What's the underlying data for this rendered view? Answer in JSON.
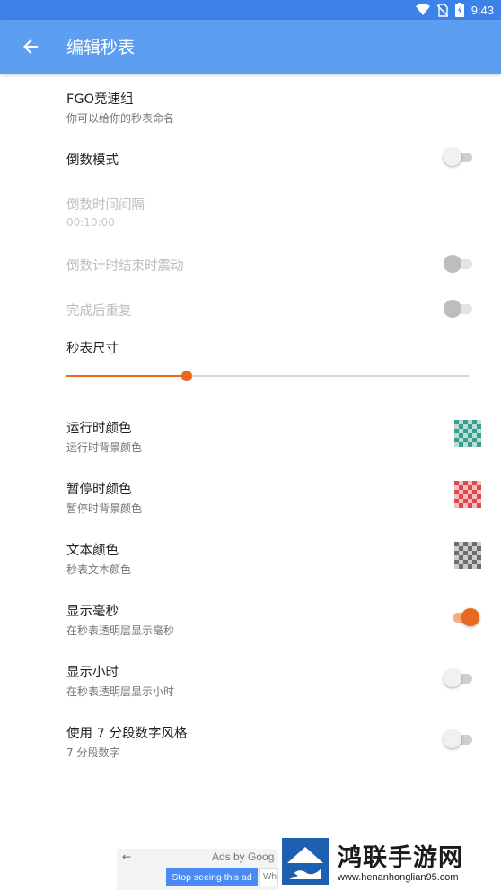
{
  "status_bar": {
    "time": "9:43",
    "icons": [
      "wifi-icon",
      "no-sim-icon",
      "battery-icon"
    ]
  },
  "app_bar": {
    "title": "编辑秒表",
    "back_icon": "arrow-back-icon"
  },
  "settings": {
    "name": {
      "title": "FGO竞速组",
      "summary": "你可以给你的秒表命名"
    },
    "countdown_mode": {
      "title": "倒数模式",
      "on": false
    },
    "countdown_interval": {
      "title": "倒数时间间隔",
      "summary": "00:10:00",
      "enabled": false
    },
    "vibrate_on_end": {
      "title": "倒数计时结束时震动",
      "on": false,
      "enabled": false
    },
    "repeat_after_done": {
      "title": "完成后重复",
      "on": false,
      "enabled": false
    },
    "stopwatch_size": {
      "title": "秒表尺寸",
      "value": 0.3
    },
    "running_color": {
      "title": "运行时颜色",
      "summary": "运行时背景颜色",
      "color": "#3a9e8c"
    },
    "paused_color": {
      "title": "暂停时颜色",
      "summary": "暂停时背景颜色",
      "color": "#e0474c"
    },
    "text_color": {
      "title": "文本颜色",
      "summary": "秒表文本颜色",
      "color": "#6e6e6e"
    },
    "show_milliseconds": {
      "title": "显示毫秒",
      "summary": "在秒表透明层显示毫秒",
      "on": true
    },
    "show_hours": {
      "title": "显示小时",
      "summary": "在秒表透明层显示小时",
      "on": false
    },
    "seven_segment": {
      "title": "使用 7 分段数字风格",
      "summary": "7 分段数字",
      "on": false
    }
  },
  "ad": {
    "ads_by": "Ads by Goog",
    "stop_label": "Stop seeing this ad",
    "why_label": "Wh"
  },
  "watermark": {
    "name": "鸿联手游网",
    "url": "www.henanhonglian95.com"
  },
  "colors": {
    "accent": "#e8691e",
    "app_bar": "#5d9ef0",
    "status_bar": "#3c82e8"
  }
}
